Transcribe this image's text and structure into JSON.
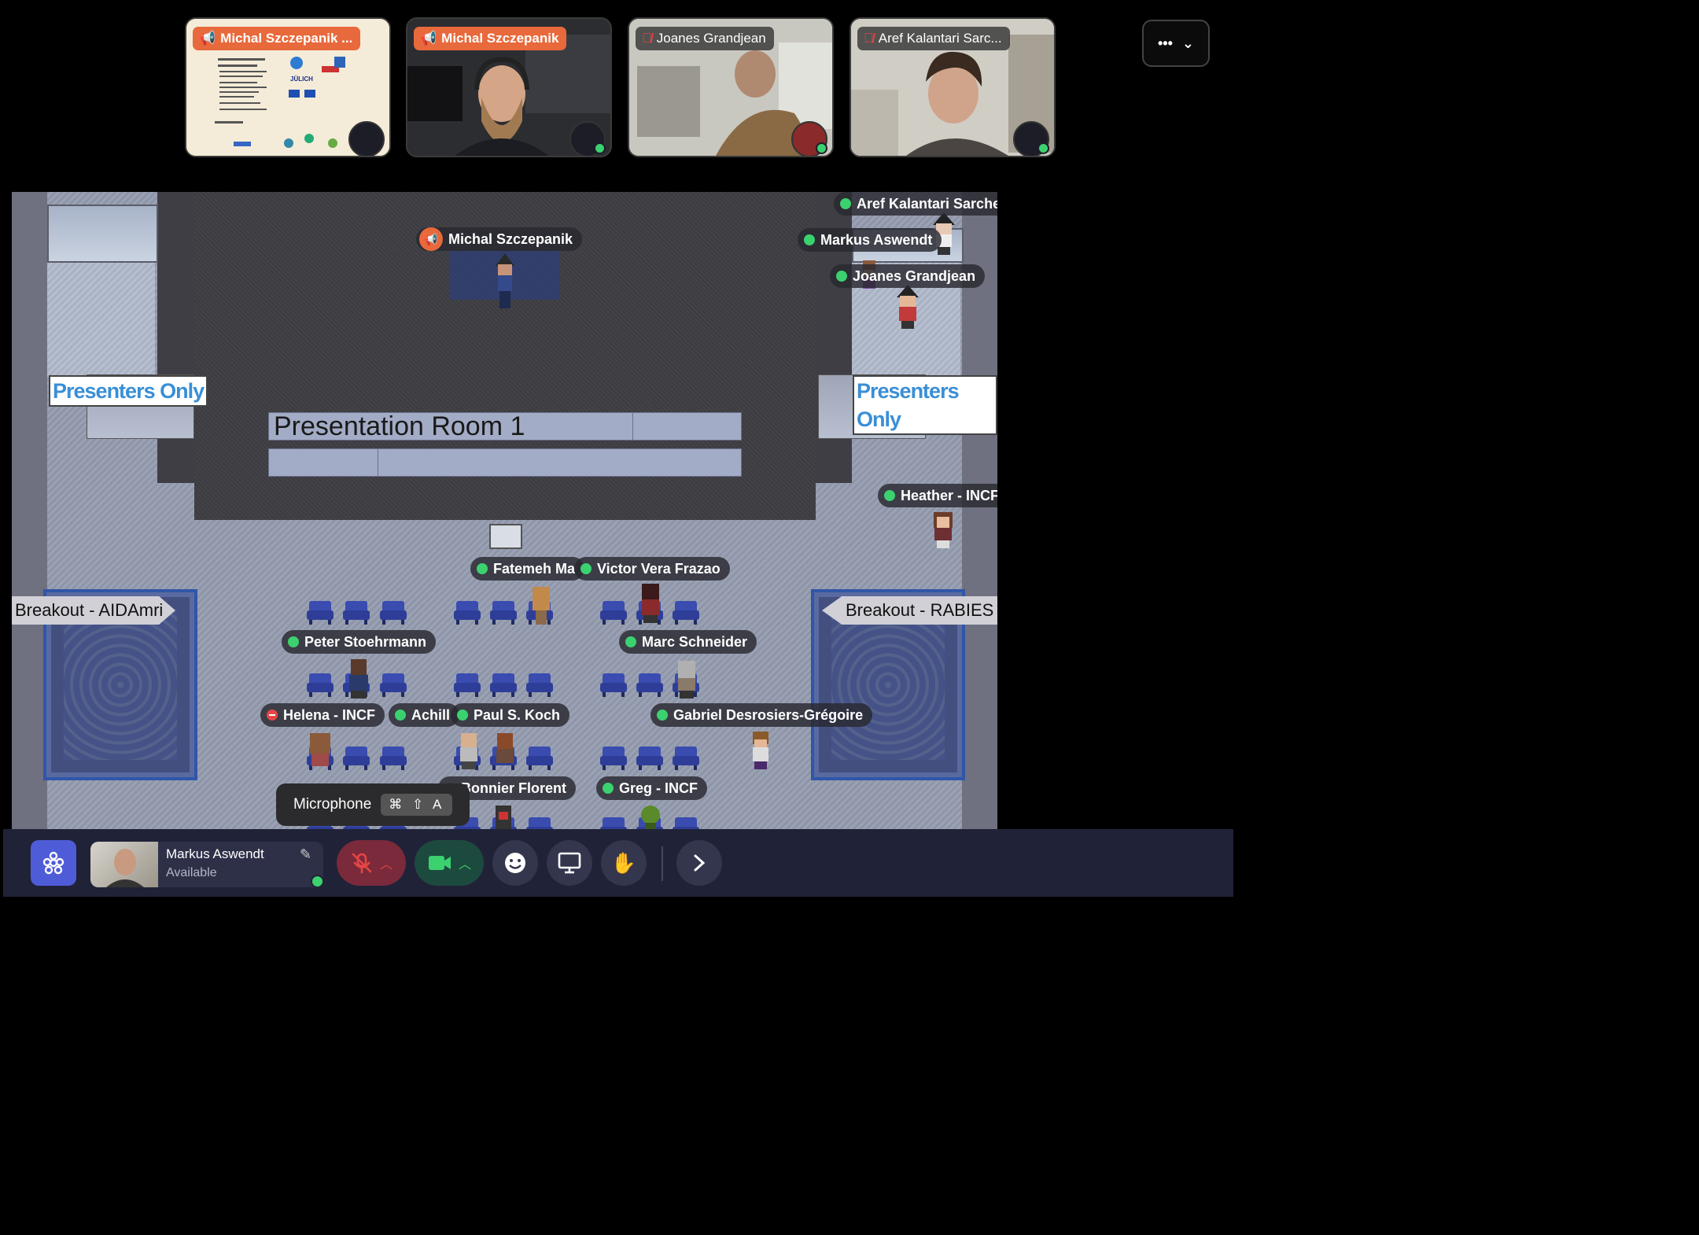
{
  "participants": [
    {
      "name": "Michal Szczepanik ...",
      "style": "orange",
      "icon": "megaphone-icon",
      "slide_title": "DataLad software & ecosystem"
    },
    {
      "name": "Michal Szczepanik",
      "style": "orange",
      "icon": "megaphone-icon"
    },
    {
      "name": "Joanes Grandjean",
      "style": "dark",
      "icon": "mic-muted-icon"
    },
    {
      "name": "Aref Kalantari Sarc...",
      "style": "dark",
      "icon": "mic-muted-icon"
    }
  ],
  "more_menu": {
    "label": "•••"
  },
  "room": {
    "title": "Presentation Room 1",
    "presenters_sign": "Presenters Only",
    "breakout_left": "Breakout - AIDAmri",
    "breakout_right": "Breakout - RABIES"
  },
  "map_labels": [
    {
      "name": "Aref Kalantari Sarcheshmeh",
      "status": "available"
    },
    {
      "name": "Michal Szczepanik",
      "status": "presenting"
    },
    {
      "name": "Markus Aswendt",
      "status": "available"
    },
    {
      "name": "Joanes Grandjean",
      "status": "available"
    },
    {
      "name": "Heather - INCF",
      "status": "available"
    },
    {
      "name": "Fatemeh Ma",
      "status": "available"
    },
    {
      "name": "Victor Vera Frazao",
      "status": "available"
    },
    {
      "name": "Peter Stoehrmann",
      "status": "available"
    },
    {
      "name": "Marc Schneider",
      "status": "available"
    },
    {
      "name": "Helena - INCF",
      "status": "busy"
    },
    {
      "name": "Achill",
      "status": "available"
    },
    {
      "name": "Paul S. Koch",
      "status": "available"
    },
    {
      "name": "Gabriel Desrosiers-Grégoire",
      "status": "available"
    },
    {
      "name": "Bonnier Florent",
      "status": "available"
    },
    {
      "name": "Greg - INCF",
      "status": "available"
    }
  ],
  "tooltip": {
    "label": "Microphone",
    "shortcut": "⌘ ⇧ A"
  },
  "self": {
    "name": "Markus Aswendt",
    "status": "Available"
  },
  "colors": {
    "accent": "#4f5cd8",
    "orange": "#e8693b",
    "green": "#3bd16f",
    "red": "#e64545",
    "bar": "#202238"
  }
}
